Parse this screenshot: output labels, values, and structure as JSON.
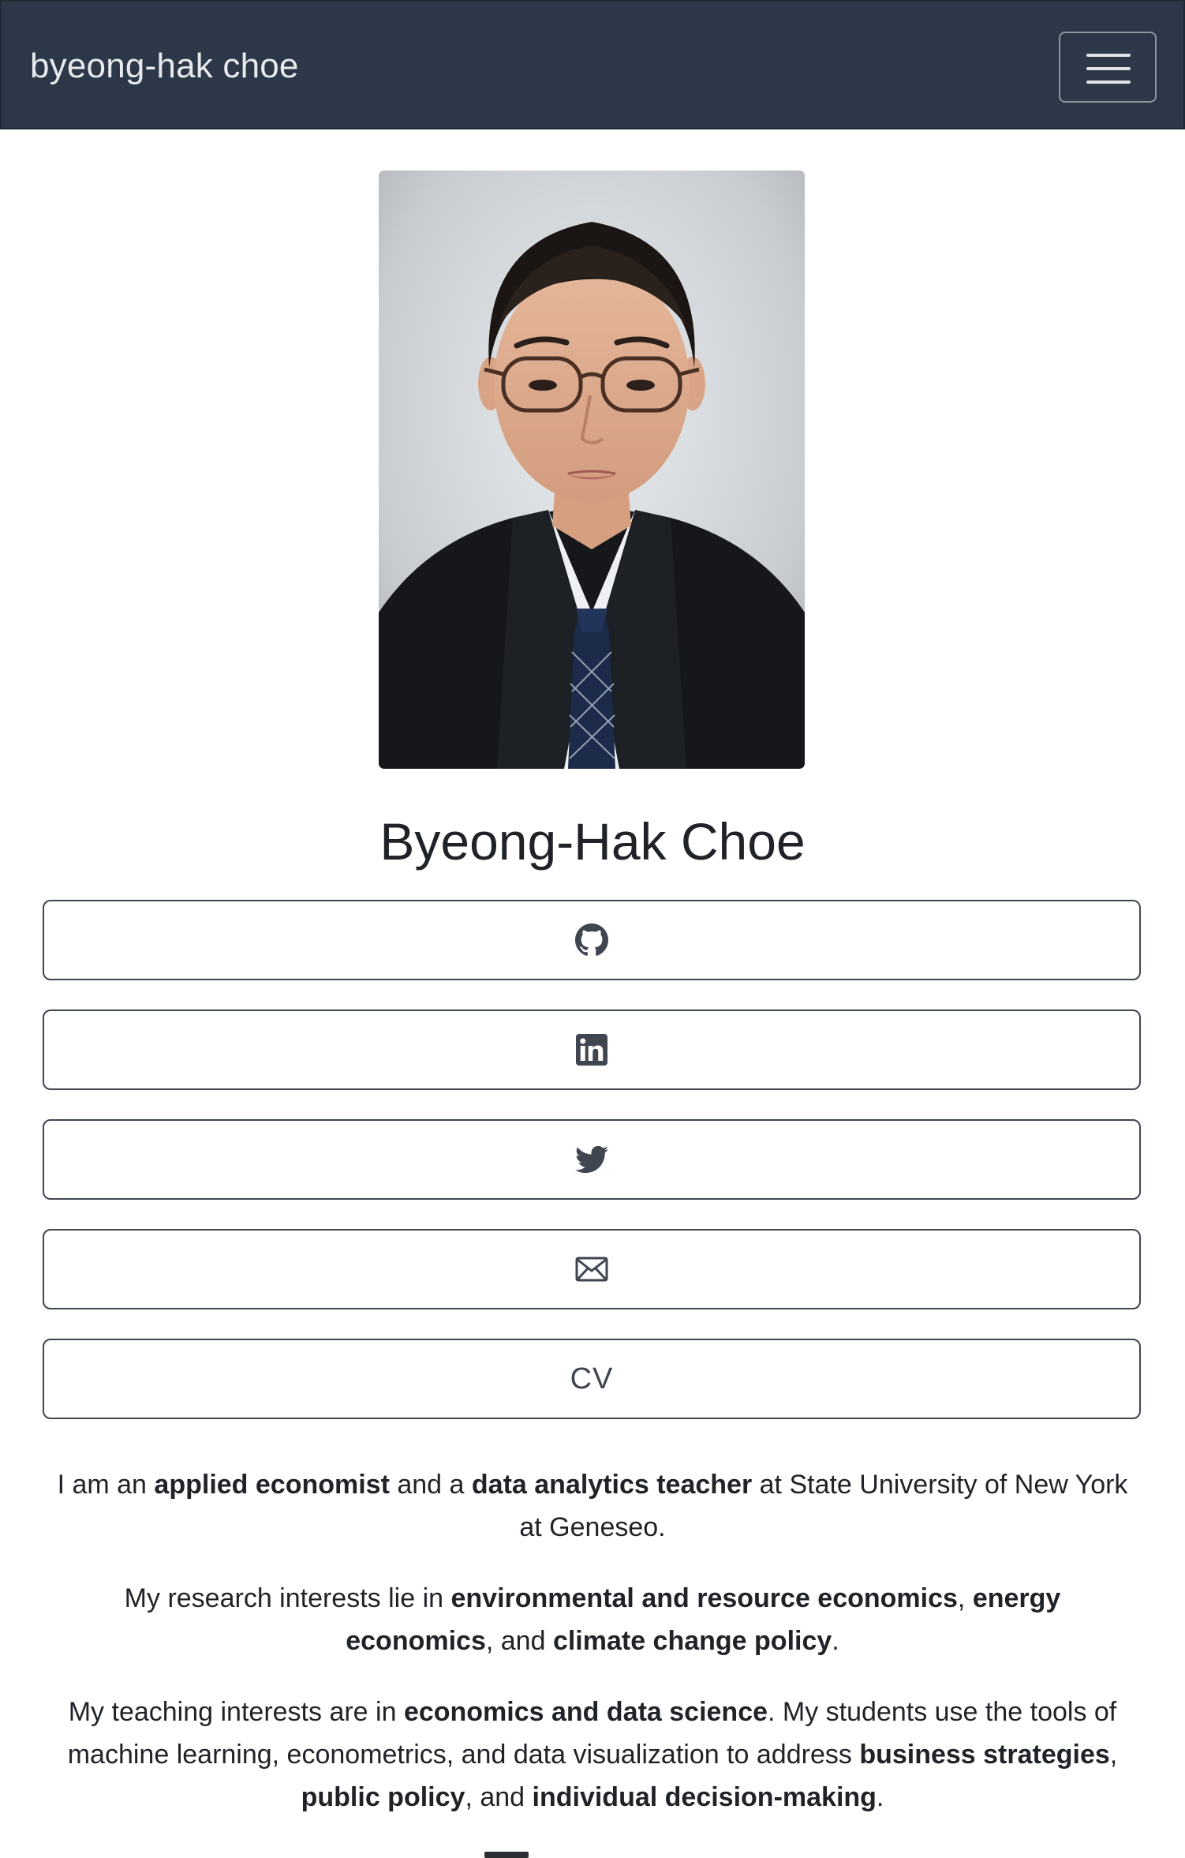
{
  "navbar": {
    "brand": "byeong-hak choe",
    "toggle_icon": "hamburger-menu-icon"
  },
  "profile": {
    "name": "Byeong-Hak Choe"
  },
  "links": [
    {
      "id": "github",
      "icon": "github-icon",
      "label": ""
    },
    {
      "id": "linkedin",
      "icon": "linkedin-icon",
      "label": ""
    },
    {
      "id": "twitter",
      "icon": "twitter-icon",
      "label": ""
    },
    {
      "id": "email",
      "icon": "envelope-icon",
      "label": ""
    },
    {
      "id": "cv",
      "icon": "",
      "label": "CV"
    }
  ],
  "bio": {
    "p1": {
      "t1": "I am an ",
      "b1": "applied economist",
      "t2": " and a ",
      "b2": "data analytics teacher",
      "t3": " at State University of New York at Geneseo."
    },
    "p2": {
      "t1": "My research interests lie in ",
      "b1": "environmental and resource economics",
      "t2": ", ",
      "b2": "energy economics",
      "t3": ", and ",
      "b3": "climate change policy",
      "t4": "."
    },
    "p3": {
      "t1": "My teaching interests are in ",
      "b1": "economics and data science",
      "t2": ". My students use the tools of machine learning, econometrics, and data visualization to address ",
      "b2": "business strategies",
      "t3": ", ",
      "b3": "public policy",
      "t4": ", and ",
      "b4": "individual decision-making",
      "t5": "."
    }
  },
  "colors": {
    "navbar_bg": "#2c3847",
    "brand_text": "#e6e9ed",
    "button_border": "#3f4650",
    "text": "#1f2328"
  }
}
